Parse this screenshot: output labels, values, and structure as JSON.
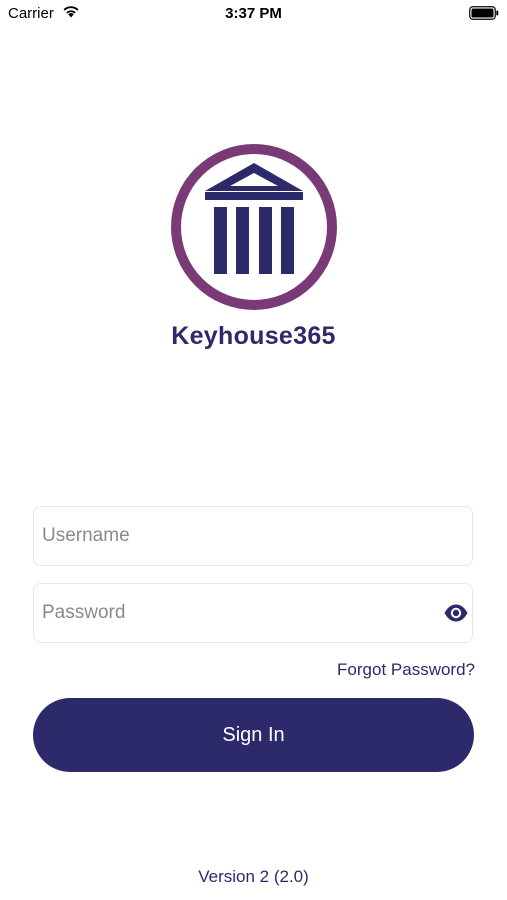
{
  "status_bar": {
    "carrier": "Carrier",
    "time": "3:37 PM",
    "icons": [
      "wifi-icon",
      "battery-icon"
    ]
  },
  "brand": {
    "name": "Keyhouse365",
    "logo_icon": "courthouse-columns-icon",
    "ring_color": "#7a3a78",
    "primary_color": "#2d2a6b"
  },
  "login": {
    "username_placeholder": "Username",
    "username_value": "",
    "password_placeholder": "Password",
    "password_value": "",
    "password_toggle_icon": "eye-icon",
    "forgot_password": "Forgot Password?",
    "sign_in": "Sign In"
  },
  "footer": {
    "version": "Version 2 (2.0)"
  }
}
